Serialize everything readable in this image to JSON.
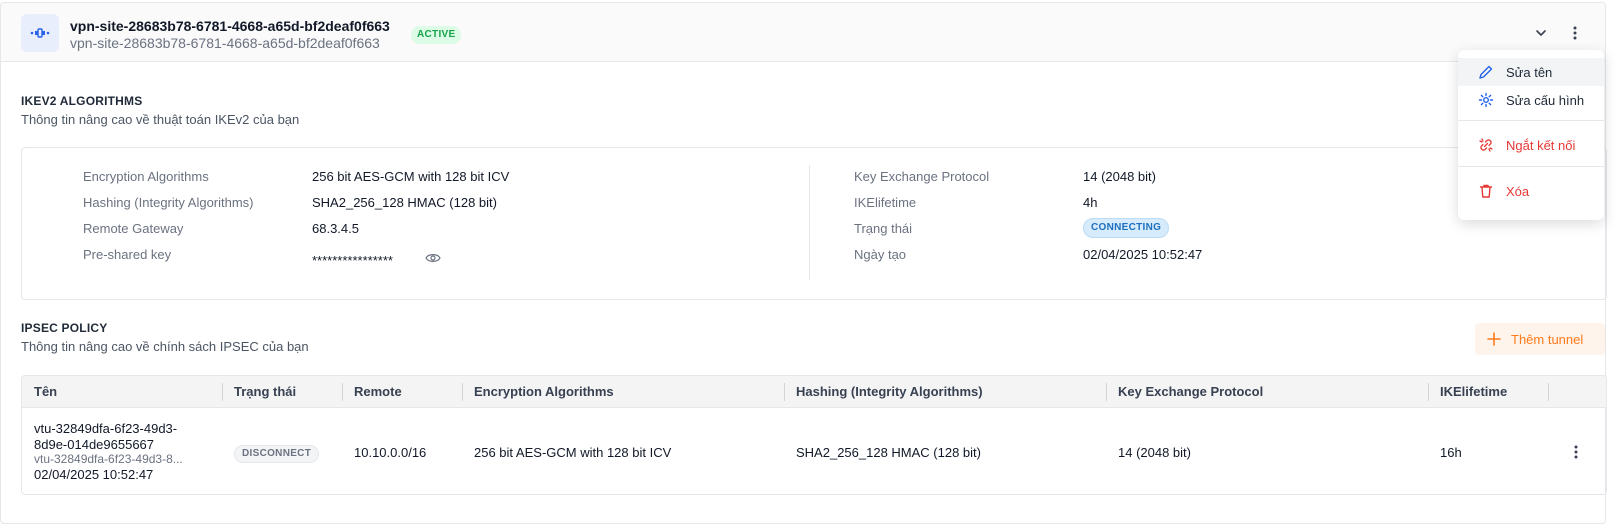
{
  "header": {
    "title": "vpn-site-28683b78-6781-4668-a65d-bf2deaf0f663",
    "subtitle": "vpn-site-28683b78-6781-4668-a65d-bf2deaf0f663",
    "status": "ACTIVE"
  },
  "ikev2": {
    "title": "IKEV2 ALGORITHMS",
    "description": "Thông tin nâng cao về thuật toán IKEv2 của bạn",
    "left": [
      {
        "label": "Encryption Algorithms",
        "value": "256 bit AES-GCM with 128 bit ICV"
      },
      {
        "label": "Hashing (Integrity Algorithms)",
        "value": "SHA2_256_128 HMAC (128 bit)"
      },
      {
        "label": "Remote Gateway",
        "value": "68.3.4.5"
      },
      {
        "label": "Pre-shared key",
        "value": "****************"
      }
    ],
    "right": [
      {
        "label": "Key Exchange Protocol",
        "value": "14 (2048 bit)"
      },
      {
        "label": "IKElifetime",
        "value": "4h"
      },
      {
        "label": "Trạng thái",
        "value": "CONNECTING"
      },
      {
        "label": "Ngày tạo",
        "value": "02/04/2025 10:52:47"
      }
    ]
  },
  "ipsec": {
    "title": "IPSEC POLICY",
    "description": "Thông tin nâng cao về chính sách IPSEC của bạn",
    "add_button": "Thêm tunnel",
    "columns": [
      "Tên",
      "Trạng thái",
      "Remote",
      "Encryption Algorithms",
      "Hashing (Integrity Algorithms)",
      "Key Exchange Protocol",
      "IKElifetime"
    ],
    "rows": [
      {
        "name_line1": "vtu-32849dfa-6f23-49d3-",
        "name_line2": "8d9e-014de9655667",
        "name_sub": "vtu-32849dfa-6f23-49d3-8...",
        "created": "02/04/2025 10:52:47",
        "status": "DISCONNECT",
        "remote": "10.10.0.0/16",
        "encryption": "256 bit AES-GCM with 128 bit ICV",
        "hashing": "SHA2_256_128 HMAC (128 bit)",
        "key_exchange": "14 (2048 bit)",
        "lifetime": "16h"
      }
    ]
  },
  "menu": {
    "rename": "Sửa tên",
    "edit_config": "Sửa cấu hình",
    "disconnect": "Ngắt kết nối",
    "delete": "Xóa"
  },
  "colors": {
    "accent": "#ff7a1a",
    "danger": "#e53935",
    "primary": "#2563eb",
    "active": "#16a34a"
  }
}
